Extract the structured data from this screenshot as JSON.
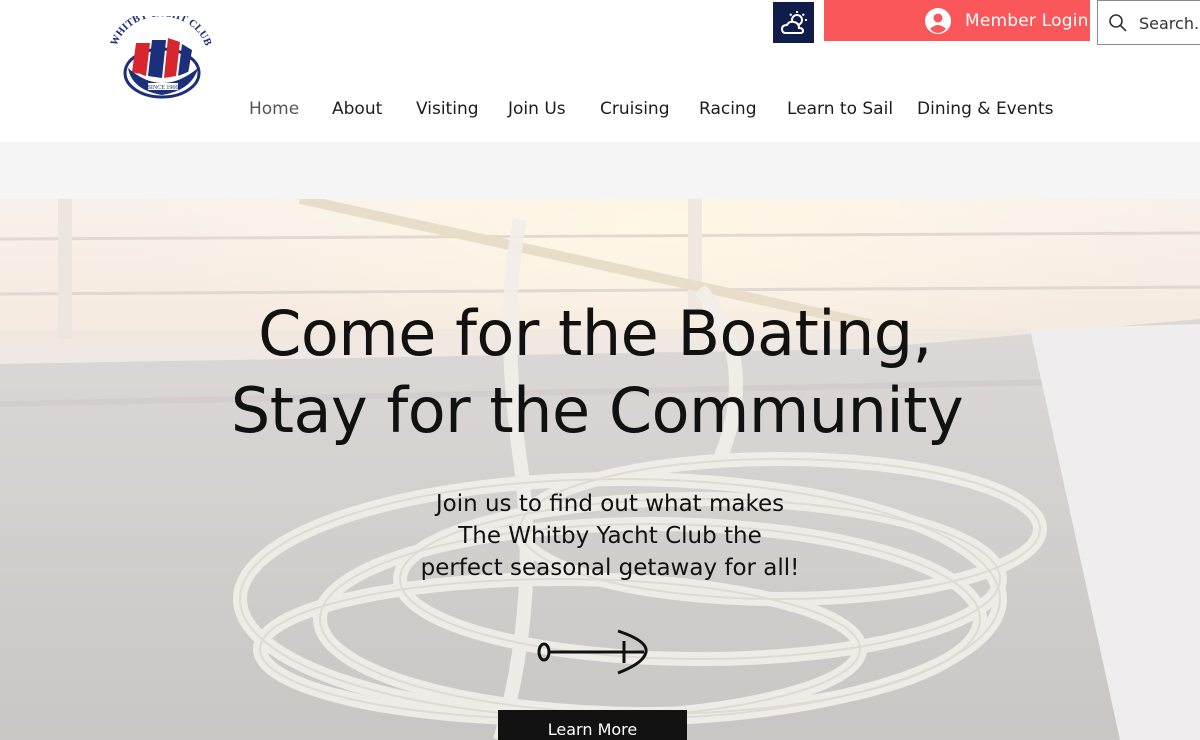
{
  "header": {
    "logo": {
      "arc_text": "WHITBY YACHT CLUB",
      "since_text": "SINCE 1966"
    },
    "weather": {
      "icon": "weather-sun-cloud-icon"
    },
    "member_login": {
      "label": "Member Login",
      "icon": "user-avatar-icon"
    },
    "search": {
      "placeholder": "Search...",
      "icon": "search-icon"
    }
  },
  "nav": {
    "items": [
      {
        "label": "Home",
        "active": true
      },
      {
        "label": "About"
      },
      {
        "label": "Visiting"
      },
      {
        "label": "Join Us"
      },
      {
        "label": "Cruising"
      },
      {
        "label": "Racing"
      },
      {
        "label": "Learn to Sail"
      },
      {
        "label": "Dining & Events"
      }
    ]
  },
  "hero": {
    "headline_line1": "Come for the Boating,",
    "headline_line2": "Stay for the Community",
    "sub_line1": "Join us to find out what makes",
    "sub_line2": "The Whitby Yacht Club the",
    "sub_line3": "perfect seasonal getaway for all!",
    "arrow_icon": "anchor-arrow-icon",
    "cta_label": "Learn More"
  },
  "colors": {
    "login_bg": "#fa575a",
    "weather_bg": "#101d4a",
    "cta_bg": "#121212",
    "band_bg": "#f5f5f5"
  }
}
